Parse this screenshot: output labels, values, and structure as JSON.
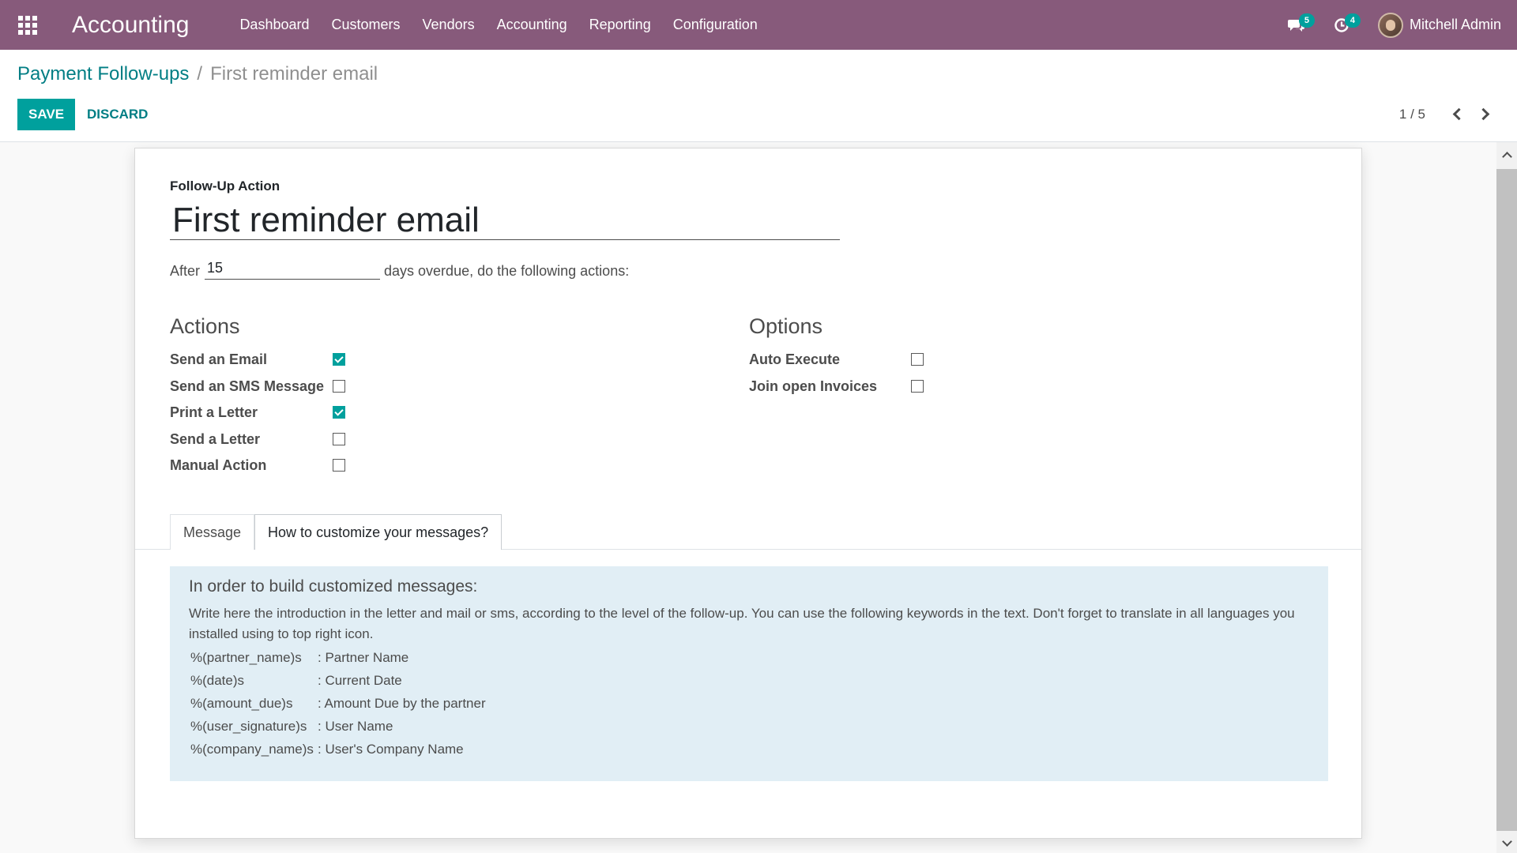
{
  "app": {
    "title": "Accounting",
    "nav": [
      "Dashboard",
      "Customers",
      "Vendors",
      "Accounting",
      "Reporting",
      "Configuration"
    ],
    "messages_count": "5",
    "activities_count": "4",
    "user_name": "Mitchell Admin",
    "accent_color": "#875a7b",
    "primary_color": "#00a09d"
  },
  "breadcrumb": {
    "parent": "Payment Follow-ups",
    "separator": "/",
    "current": "First reminder email"
  },
  "toolbar": {
    "save_label": "SAVE",
    "discard_label": "DISCARD",
    "pager": "1 / 5"
  },
  "form": {
    "section_label": "Follow-Up Action",
    "name": "First reminder email",
    "after_label": "After",
    "delay_days": "15",
    "after_suffix": "days overdue, do the following actions:",
    "actions_title": "Actions",
    "actions": [
      {
        "label": "Send an Email",
        "checked": true
      },
      {
        "label": "Send an SMS Message",
        "checked": false
      },
      {
        "label": "Print a Letter",
        "checked": true
      },
      {
        "label": "Send a Letter",
        "checked": false
      },
      {
        "label": "Manual Action",
        "checked": false
      }
    ],
    "options_title": "Options",
    "options": [
      {
        "label": "Auto Execute",
        "checked": false
      },
      {
        "label": "Join open Invoices",
        "checked": false
      }
    ]
  },
  "notebook": {
    "tabs": [
      "Message",
      "How to customize your messages?"
    ],
    "active_tab": 1,
    "help_heading": "In order to build customized messages:",
    "help_intro": "Write here the introduction in the letter and mail or sms, according to the level of the follow-up. You can use the following keywords in the text. Don't forget to translate in all languages you installed using to top right icon.",
    "keywords": [
      {
        "key": "%(partner_name)s",
        "desc": ": Partner Name"
      },
      {
        "key": "%(date)s",
        "desc": ": Current Date"
      },
      {
        "key": "%(amount_due)s",
        "desc": ": Amount Due by the partner"
      },
      {
        "key": "%(user_signature)s",
        "desc": ": User Name"
      },
      {
        "key": "%(company_name)s",
        "desc": ": User's Company Name"
      }
    ]
  }
}
